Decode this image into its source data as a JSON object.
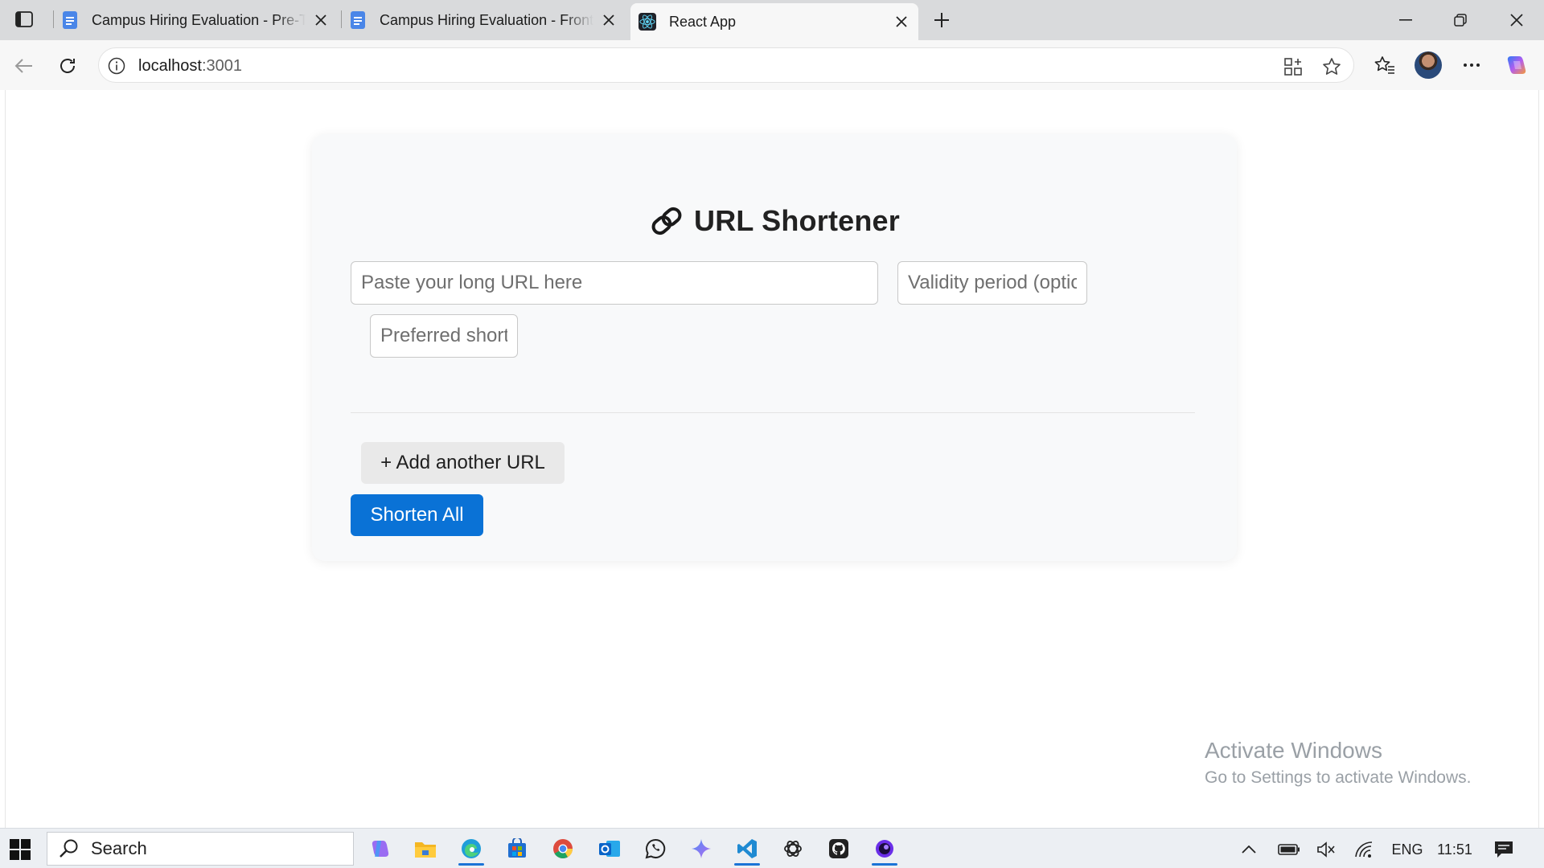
{
  "browser": {
    "tabs": [
      {
        "title": "Campus Hiring Evaluation - Pre-Te",
        "favicon": "docs-icon",
        "active": false
      },
      {
        "title": "Campus Hiring Evaluation - Fronte",
        "favicon": "docs-icon",
        "active": false
      },
      {
        "title": "React App",
        "favicon": "react-icon",
        "active": true
      }
    ],
    "address": {
      "host": "localhost",
      "port": ":3001"
    }
  },
  "page": {
    "title": "URL Shortener",
    "long_url_placeholder": "Paste your long URL here",
    "validity_placeholder": "Validity period (optional)",
    "shortcode_placeholder": "Preferred shortcode (optional)",
    "add_button_label": "+ Add another URL",
    "shorten_button_label": "Shorten All"
  },
  "watermark": {
    "line1": "Activate Windows",
    "line2": "Go to Settings to activate Windows."
  },
  "taskbar": {
    "search_label": "Search",
    "language": "ENG",
    "time": "11:51"
  },
  "colors": {
    "primary_button": "#0a72d6",
    "card_background": "#f8f9fa",
    "taskbar": "#eceff3"
  }
}
